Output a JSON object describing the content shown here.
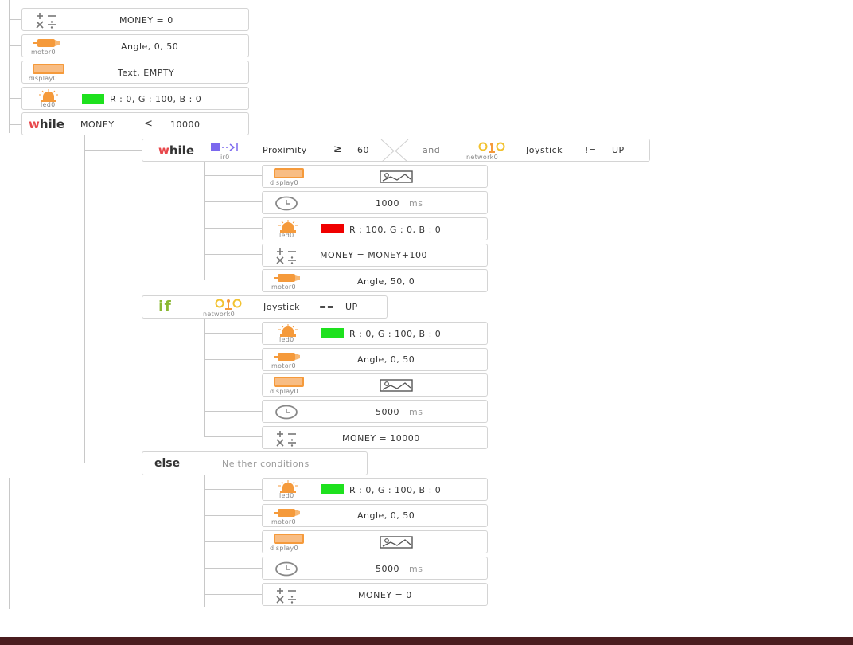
{
  "colors": {
    "green": "#1ee11e",
    "red": "#f00000",
    "orange": "#f59a3b",
    "purple": "#7b68ee",
    "connector": "#c8c8c8"
  },
  "blocks": {
    "b1": {
      "text": "MONEY = 0",
      "icon": "math-operators-icon"
    },
    "b2": {
      "text": "Angle, 0, 50",
      "device": "motor0",
      "icon": "motor-icon"
    },
    "b3": {
      "text": "Text, EMPTY",
      "device": "display0",
      "icon": "display-icon"
    },
    "b4": {
      "text": "R : 0, G : 100, B : 0",
      "device": "led0",
      "icon": "led-icon"
    },
    "while_outer": {
      "keyword_w": "w",
      "keyword_rest": "hile",
      "var": "MONEY",
      "op": "<",
      "value": "10000"
    },
    "while_inner": {
      "keyword_w": "w",
      "keyword_rest": "hile",
      "sensor_device": "ir0",
      "sensor": "Proximity",
      "op": "≥",
      "value": "60",
      "conj": "and",
      "device2": "network0",
      "cond2": "Joystick",
      "op2": "!=",
      "value2": "UP"
    },
    "w1": {
      "device": "display0",
      "icon": "display-icon"
    },
    "w2": {
      "text": "1000",
      "unit": "ms",
      "icon": "clock-icon"
    },
    "w3": {
      "text": "R : 100, G : 0, B : 0",
      "device": "led0",
      "icon": "led-icon"
    },
    "w4": {
      "text": "MONEY = MONEY+100",
      "icon": "math-operators-icon"
    },
    "w5": {
      "text": "Angle, 50, 0",
      "device": "motor0",
      "icon": "motor-icon"
    },
    "if": {
      "keyword": "if",
      "device": "network0",
      "cond": "Joystick",
      "op": "==",
      "value": "UP"
    },
    "i1": {
      "text": "R : 0, G : 100, B : 0",
      "device": "led0"
    },
    "i2": {
      "text": "Angle, 0, 50",
      "device": "motor0"
    },
    "i3": {
      "device": "display0"
    },
    "i4": {
      "text": "5000",
      "unit": "ms"
    },
    "i5": {
      "text": "MONEY = 10000"
    },
    "else": {
      "keyword": "else",
      "desc": "Neither conditions"
    },
    "e1": {
      "text": "R : 0, G : 100, B : 0",
      "device": "led0"
    },
    "e2": {
      "text": "Angle, 0, 50",
      "device": "motor0"
    },
    "e3": {
      "device": "display0"
    },
    "e4": {
      "text": "5000",
      "unit": "ms"
    },
    "e5": {
      "text": "MONEY = 0"
    }
  }
}
